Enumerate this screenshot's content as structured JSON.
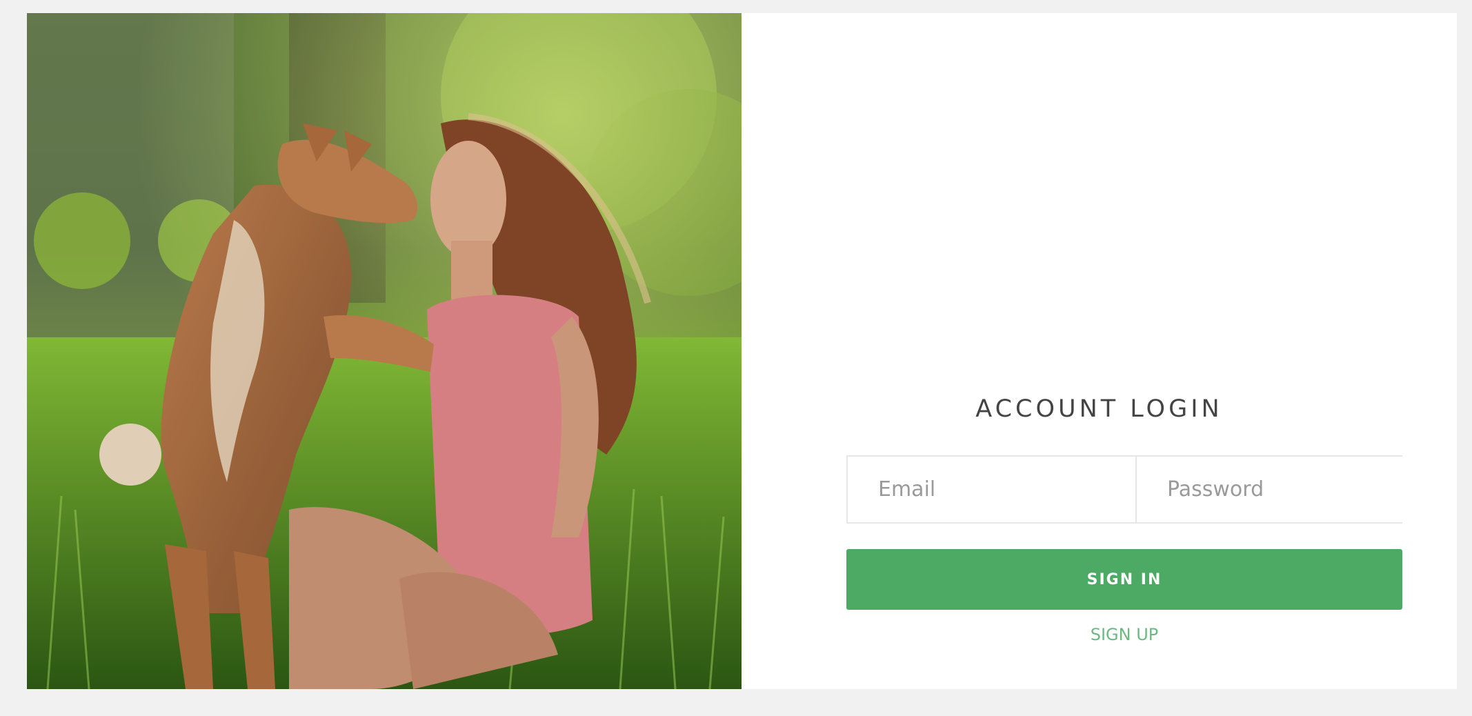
{
  "login": {
    "title": "ACCOUNT LOGIN",
    "email_placeholder": "Email",
    "password_placeholder": "Password",
    "signin_label": "SIGN IN",
    "signup_label": "SIGN UP"
  },
  "colors": {
    "page_bg": "#f1f1f1",
    "card_bg": "#ffffff",
    "accent": "#4caa65",
    "link": "#6cb982"
  },
  "photo": {
    "subject": "woman-and-dog-photo"
  }
}
